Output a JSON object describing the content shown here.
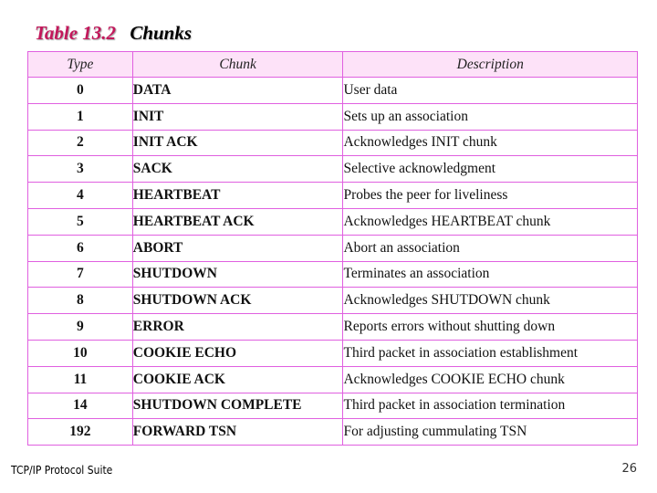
{
  "title": {
    "number": "Table 13.2",
    "name": "Chunks"
  },
  "table": {
    "headers": [
      "Type",
      "Chunk",
      "Description"
    ],
    "rows": [
      {
        "type": "0",
        "chunk": "DATA",
        "description": "User data"
      },
      {
        "type": "1",
        "chunk": "INIT",
        "description": "Sets up an association"
      },
      {
        "type": "2",
        "chunk": "INIT ACK",
        "description": "Acknowledges INIT chunk"
      },
      {
        "type": "3",
        "chunk": "SACK",
        "description": "Selective acknowledgment"
      },
      {
        "type": "4",
        "chunk": "HEARTBEAT",
        "description": "Probes the peer for liveliness"
      },
      {
        "type": "5",
        "chunk": "HEARTBEAT ACK",
        "description": "Acknowledges HEARTBEAT chunk"
      },
      {
        "type": "6",
        "chunk": "ABORT",
        "description": "Abort an association"
      },
      {
        "type": "7",
        "chunk": "SHUTDOWN",
        "description": "Terminates an association"
      },
      {
        "type": "8",
        "chunk": "SHUTDOWN ACK",
        "description": "Acknowledges SHUTDOWN chunk"
      },
      {
        "type": "9",
        "chunk": "ERROR",
        "description": "Reports errors without shutting down"
      },
      {
        "type": "10",
        "chunk": "COOKIE ECHO",
        "description": "Third packet in association establishment"
      },
      {
        "type": "11",
        "chunk": "COOKIE ACK",
        "description": "Acknowledges COOKIE ECHO chunk"
      },
      {
        "type": "14",
        "chunk": "SHUTDOWN COMPLETE",
        "description": "Third packet in association termination"
      },
      {
        "type": "192",
        "chunk": "FORWARD TSN",
        "description": "For adjusting cummulating TSN"
      }
    ]
  },
  "footer": {
    "left": "TCP/IP Protocol Suite",
    "page_number": "26"
  },
  "colors": {
    "title_accent": "#c2185b",
    "border": "#e060e0",
    "header_bg": "#fde2f8"
  }
}
